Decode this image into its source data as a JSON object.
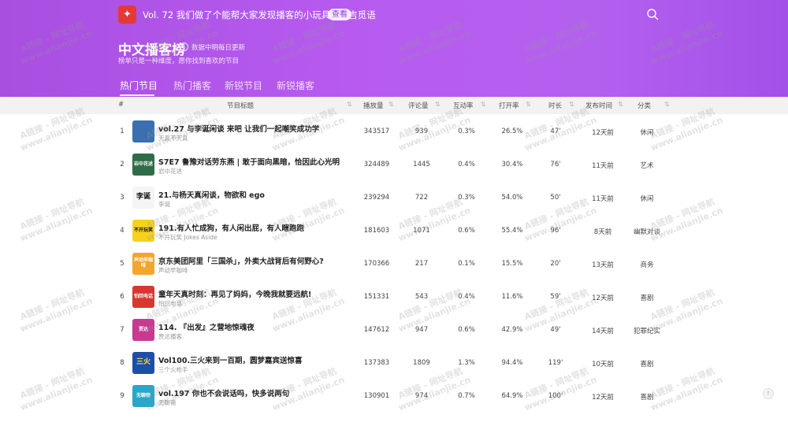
{
  "topbar": {
    "announcement": "Vol. 72 我们做了个能帮大家发现播客的小玩具 - 飘吉觅语",
    "view_button": "查看",
    "logo_glyph": "✦"
  },
  "header": {
    "title": "中文播客榜",
    "update_note": "数据中明每日更新",
    "subtitle": "榜单只是一种维度，愿你找到喜欢的节目"
  },
  "tabs": [
    {
      "label": "热门节目",
      "active": true
    },
    {
      "label": "热门播客",
      "active": false
    },
    {
      "label": "新锐节目",
      "active": false
    },
    {
      "label": "新锐播客",
      "active": false
    }
  ],
  "columns": {
    "rank": "#",
    "title": "节目标题",
    "plays": "播放量",
    "comments": "评论量",
    "interaction": "互动率",
    "open_rate": "打开率",
    "duration": "时长",
    "published": "发布时间",
    "category": "分类"
  },
  "rows": [
    {
      "rank": "1",
      "title": "vol.27 与李诞闲谈 来吧 让我们一起嘲笑成功学",
      "podcast": "天真不天真",
      "plays": "343517",
      "comments": "939",
      "interaction": "0.3%",
      "open_rate": "26.5%",
      "duration": "47'",
      "published": "12天前",
      "category": "休闲",
      "cover": {
        "bg": "#3b6fb0",
        "text": ""
      }
    },
    {
      "rank": "2",
      "title": "S7E7 鲁豫对话劳东燕 | 敢于面向黑暗，恰因此心光明",
      "podcast": "岩中花述",
      "plays": "324489",
      "comments": "1445",
      "interaction": "0.4%",
      "open_rate": "30.4%",
      "duration": "76'",
      "published": "11天前",
      "category": "艺术",
      "cover": {
        "bg": "#2f6d4a",
        "text": "岩中花述"
      }
    },
    {
      "rank": "3",
      "title": "21.与杨天真闲谈，物欲和 ego",
      "podcast": "李诞",
      "plays": "239294",
      "comments": "722",
      "interaction": "0.3%",
      "open_rate": "54.0%",
      "duration": "50'",
      "published": "11天前",
      "category": "休闲",
      "cover": {
        "bg": "#f5f5f5",
        "text": "李诞"
      }
    },
    {
      "rank": "4",
      "title": "191.有人忙成狗，有人闲出屁，有人瞎跑跑",
      "podcast": "不开玩笑 Jokes Aside",
      "plays": "181603",
      "comments": "1071",
      "interaction": "0.6%",
      "open_rate": "55.4%",
      "duration": "96'",
      "published": "8天前",
      "category": "幽默对谈",
      "cover": {
        "bg": "#f5d21b",
        "text": "不开玩笑"
      }
    },
    {
      "rank": "5",
      "title": "京东美团阿里「三国杀」，外卖大战背后有何野心?",
      "podcast": "声动早咖啡",
      "plays": "170366",
      "comments": "217",
      "interaction": "0.1%",
      "open_rate": "15.5%",
      "duration": "20'",
      "published": "13天前",
      "category": "商务",
      "cover": {
        "bg": "#f4a62a",
        "text": "声动早咖啡"
      }
    },
    {
      "rank": "6",
      "title": "童年天真时刻：再见了妈妈，今晚我就要远航!",
      "podcast": "怕回电话",
      "plays": "151331",
      "comments": "543",
      "interaction": "0.4%",
      "open_rate": "11.6%",
      "duration": "59'",
      "published": "12天前",
      "category": "喜剧",
      "cover": {
        "bg": "#d8372f",
        "text": "怕回电话"
      }
    },
    {
      "rank": "7",
      "title": "114. 『出发』之营地惊魂夜",
      "podcast": "贾达播客",
      "plays": "147612",
      "comments": "947",
      "interaction": "0.6%",
      "open_rate": "42.9%",
      "duration": "49'",
      "published": "14天前",
      "category": "犯罪纪实",
      "cover": {
        "bg": "#c63a8f",
        "text": "贾达"
      }
    },
    {
      "rank": "8",
      "title": "Vol100.三火来到一百期，圆梦嘉宾送惊喜",
      "podcast": "三个火枪手",
      "plays": "137383",
      "comments": "1809",
      "interaction": "1.3%",
      "open_rate": "94.4%",
      "duration": "119'",
      "published": "10天前",
      "category": "喜剧",
      "cover": {
        "bg": "#1e4fa8",
        "text": "三火"
      }
    },
    {
      "rank": "9",
      "title": "vol.197 你也不会说话吗，快多说两句",
      "podcast": "无聊斋",
      "plays": "130901",
      "comments": "974",
      "interaction": "0.7%",
      "open_rate": "64.9%",
      "duration": "100'",
      "published": "12天前",
      "category": "喜剧",
      "cover": {
        "bg": "#2aa6c9",
        "text": "无聊斋"
      }
    }
  ],
  "watermark": {
    "line1": "A链接 - 网址导航",
    "line2": "www.alianjie.cn"
  },
  "colors": {
    "header": "#b35cef",
    "accent_button_text": "#8e3fd4"
  }
}
